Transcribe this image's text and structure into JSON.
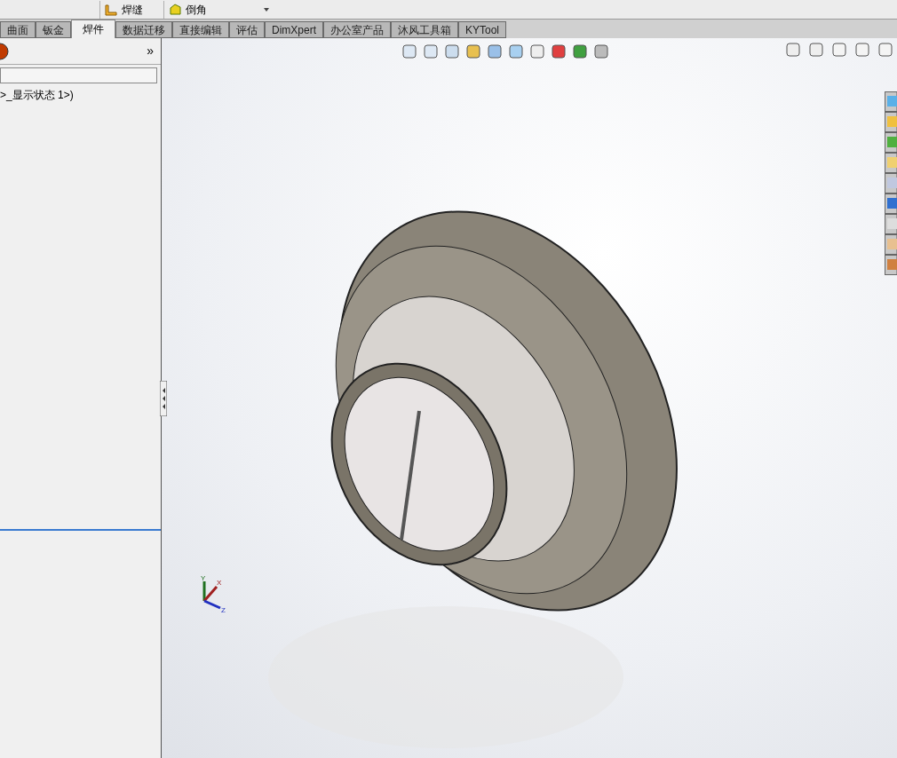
{
  "toolbar": {
    "buttons": [
      {
        "label": "焊缝"
      },
      {
        "label": "倒角"
      }
    ]
  },
  "tabs": [
    {
      "label": "曲面",
      "selected": false
    },
    {
      "label": "钣金",
      "selected": false
    },
    {
      "label": "焊件",
      "selected": true
    },
    {
      "label": "数据迁移",
      "selected": false
    },
    {
      "label": "直接编辑",
      "selected": false
    },
    {
      "label": "评估",
      "selected": false
    },
    {
      "label": "DimXpert",
      "selected": false
    },
    {
      "label": "办公室产品",
      "selected": false
    },
    {
      "label": "沐风工具箱",
      "selected": false
    },
    {
      "label": "KYTool",
      "selected": false
    }
  ],
  "feature_manager": {
    "expand": "»",
    "tree_item": ">_显示状态 1>)"
  },
  "triad": {
    "x": "X",
    "y": "Y",
    "z": "Z"
  }
}
